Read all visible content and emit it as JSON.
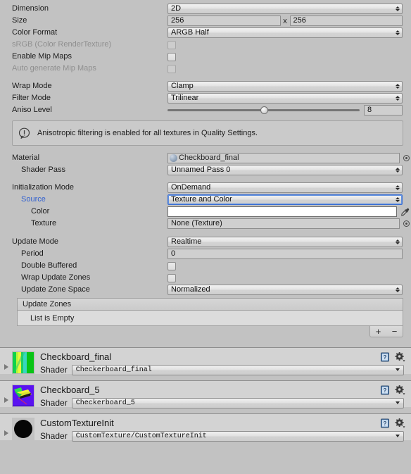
{
  "inspector": {
    "dimension": {
      "label": "Dimension",
      "value": "2D"
    },
    "size": {
      "label": "Size",
      "width": "256",
      "separator": "x",
      "height": "256"
    },
    "color_format": {
      "label": "Color Format",
      "value": "ARGB Half"
    },
    "srgb": {
      "label": "sRGB (Color RenderTexture)",
      "checked": false
    },
    "enable_mip_maps": {
      "label": "Enable Mip Maps",
      "checked": false
    },
    "auto_generate_mip_maps": {
      "label": "Auto generate Mip Maps",
      "checked": false
    },
    "wrap_mode": {
      "label": "Wrap Mode",
      "value": "Clamp"
    },
    "filter_mode": {
      "label": "Filter Mode",
      "value": "Trilinear"
    },
    "aniso_level": {
      "label": "Aniso Level",
      "value": "8",
      "slider_percent": 50
    },
    "helpbox": {
      "text": "Anisotropic filtering is enabled for all textures in Quality Settings.",
      "icon": "info-exclamation-icon"
    },
    "material": {
      "label": "Material",
      "value": "Checkboard_final"
    },
    "shader_pass": {
      "label": "Shader Pass",
      "value": "Unnamed Pass 0"
    },
    "initialization_mode": {
      "label": "Initialization Mode",
      "value": "OnDemand"
    },
    "source": {
      "label": "Source",
      "value": "Texture and Color",
      "focused": true,
      "label_color": "#2f5fd0"
    },
    "color": {
      "label": "Color",
      "value": "#ffffff"
    },
    "texture": {
      "label": "Texture",
      "value": "None (Texture)"
    },
    "update_mode": {
      "label": "Update Mode",
      "value": "Realtime"
    },
    "period": {
      "label": "Period",
      "value": "0"
    },
    "double_buffered": {
      "label": "Double Buffered",
      "checked": false
    },
    "wrap_update_zones": {
      "label": "Wrap Update Zones",
      "checked": false
    },
    "update_zone_space": {
      "label": "Update Zone Space",
      "value": "Normalized"
    },
    "update_zones": {
      "header": "Update Zones",
      "empty_text": "List is Empty",
      "add_label": "+",
      "remove_label": "−"
    }
  },
  "materials": [
    {
      "name": "Checkboard_final",
      "shader_label": "Shader",
      "shader_value": "Checkerboard_final",
      "thumb": "green-stripes"
    },
    {
      "name": "Checkboard_5",
      "shader_label": "Shader",
      "shader_value": "Checkerboard_5",
      "thumb": "purple-plane"
    },
    {
      "name": "CustomTextureInit",
      "shader_label": "Shader",
      "shader_value": "CustomTexture/CustomTextureInit",
      "thumb": "black-sphere"
    }
  ]
}
